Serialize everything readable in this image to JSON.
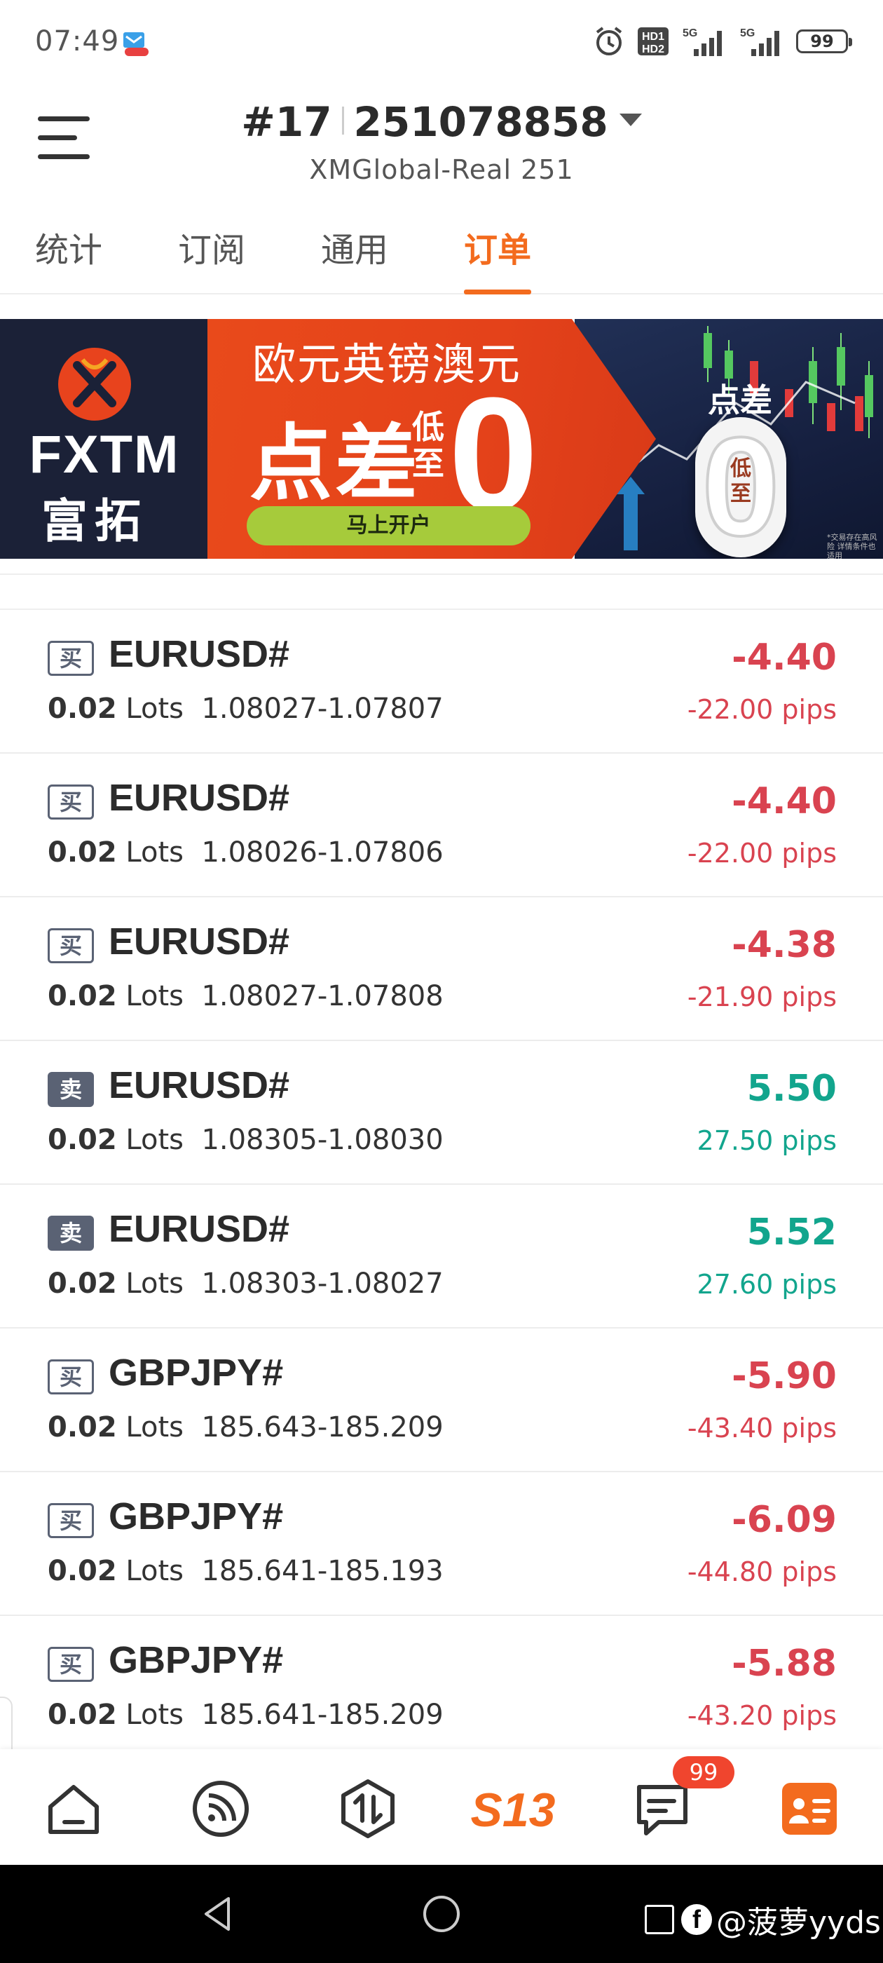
{
  "status_bar": {
    "time": "07:49",
    "battery": "99",
    "network_1": "5G",
    "network_2": "5G",
    "icons": [
      "mail-app-icon",
      "alarm-icon",
      "hd-icon",
      "signal-icon",
      "signal-icon",
      "battery-icon"
    ]
  },
  "header": {
    "account_prefix": "#17",
    "account_number": "251078858",
    "server": "XMGlobal-Real 251"
  },
  "tabs": [
    {
      "label": "统计",
      "active": false
    },
    {
      "label": "订阅",
      "active": false
    },
    {
      "label": "通用",
      "active": false
    },
    {
      "label": "订单",
      "active": true
    }
  ],
  "banner": {
    "brand": "FXTM",
    "brand_cn": "富拓",
    "headline": "欧元英镑澳元",
    "big_text": "点差",
    "low_to": "低至",
    "zero": "0",
    "cta": "马上开户",
    "right_caption": "点差",
    "right_low_to": "低至",
    "fine_print": "*交易存在高风险 详情条件也适用"
  },
  "orders": [
    {
      "type": "买",
      "side": "buy",
      "symbol": "EURUSD#",
      "lots": "0.02",
      "lots_unit": "Lots",
      "prices": "1.08027-1.07807",
      "profit": "-4.40",
      "pips": "-22.00 pips",
      "sign": "neg"
    },
    {
      "type": "买",
      "side": "buy",
      "symbol": "EURUSD#",
      "lots": "0.02",
      "lots_unit": "Lots",
      "prices": "1.08026-1.07806",
      "profit": "-4.40",
      "pips": "-22.00 pips",
      "sign": "neg"
    },
    {
      "type": "买",
      "side": "buy",
      "symbol": "EURUSD#",
      "lots": "0.02",
      "lots_unit": "Lots",
      "prices": "1.08027-1.07808",
      "profit": "-4.38",
      "pips": "-21.90 pips",
      "sign": "neg"
    },
    {
      "type": "卖",
      "side": "sell",
      "symbol": "EURUSD#",
      "lots": "0.02",
      "lots_unit": "Lots",
      "prices": "1.08305-1.08030",
      "profit": "5.50",
      "pips": "27.50 pips",
      "sign": "pos"
    },
    {
      "type": "卖",
      "side": "sell",
      "symbol": "EURUSD#",
      "lots": "0.02",
      "lots_unit": "Lots",
      "prices": "1.08303-1.08027",
      "profit": "5.52",
      "pips": "27.60 pips",
      "sign": "pos"
    },
    {
      "type": "买",
      "side": "buy",
      "symbol": "GBPJPY#",
      "lots": "0.02",
      "lots_unit": "Lots",
      "prices": "185.643-185.209",
      "profit": "-5.90",
      "pips": "-43.40 pips",
      "sign": "neg"
    },
    {
      "type": "买",
      "side": "buy",
      "symbol": "GBPJPY#",
      "lots": "0.02",
      "lots_unit": "Lots",
      "prices": "185.641-185.193",
      "profit": "-6.09",
      "pips": "-44.80 pips",
      "sign": "neg"
    },
    {
      "type": "买",
      "side": "buy",
      "symbol": "GBPJPY#",
      "lots": "0.02",
      "lots_unit": "Lots",
      "prices": "185.641-185.209",
      "profit": "-5.88",
      "pips": "-43.20 pips",
      "sign": "neg"
    }
  ],
  "bottom_nav": {
    "items": [
      "home-icon",
      "signal-feed-icon",
      "trade-icon",
      "s13-icon",
      "messages-icon",
      "profile-card-icon"
    ],
    "s13_label": "S13",
    "messages_badge": "99"
  },
  "system_nav": {
    "watermark": "@菠萝yyds",
    "icons": [
      "back-icon",
      "home-circle-icon",
      "recents-icon"
    ]
  },
  "colors": {
    "accent": "#f36b1e",
    "loss": "#d94350",
    "profit": "#12a58d",
    "badge": "#f0452e"
  }
}
